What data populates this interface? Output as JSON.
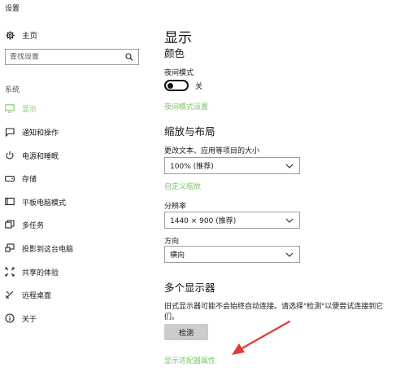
{
  "window": {
    "title": "设置"
  },
  "sidebar": {
    "home_label": "主页",
    "search_placeholder": "查找设置",
    "section_title": "系统",
    "items": [
      {
        "label": "显示",
        "icon": "monitor-icon",
        "active": true
      },
      {
        "label": "通知和操作",
        "icon": "notification-icon"
      },
      {
        "label": "电源和睡眠",
        "icon": "power-icon"
      },
      {
        "label": "存储",
        "icon": "storage-icon"
      },
      {
        "label": "平板电脑模式",
        "icon": "tablet-mode-icon"
      },
      {
        "label": "多任务",
        "icon": "multitasking-icon"
      },
      {
        "label": "投影到这台电脑",
        "icon": "project-icon"
      },
      {
        "label": "共享的体验",
        "icon": "shared-experiences-icon"
      },
      {
        "label": "远程桌面",
        "icon": "remote-desktop-icon"
      },
      {
        "label": "关于",
        "icon": "info-icon"
      }
    ]
  },
  "main": {
    "title": "显示",
    "color": {
      "heading": "颜色",
      "night_light_label": "夜间模式",
      "night_light_state": "关",
      "night_light_settings_link": "夜间模式设置"
    },
    "scale": {
      "heading": "缩放与布局",
      "text_size_label": "更改文本、应用等项目的大小",
      "text_size_value": "100% (推荐)",
      "custom_scaling_link": "自定义缩放",
      "resolution_label": "分辨率",
      "resolution_value": "1440 × 900 (推荐)",
      "orientation_label": "方向",
      "orientation_value": "横向"
    },
    "multi": {
      "heading": "多个显示器",
      "description": "旧式显示器可能不会始终自动连接。请选择\"检测\"以便尝试连接到它们。",
      "detect_button": "检测",
      "adapter_link": "显示适配器属性"
    }
  },
  "colors": {
    "accent": "#7cc36a",
    "annotation_arrow": "#e53935"
  }
}
